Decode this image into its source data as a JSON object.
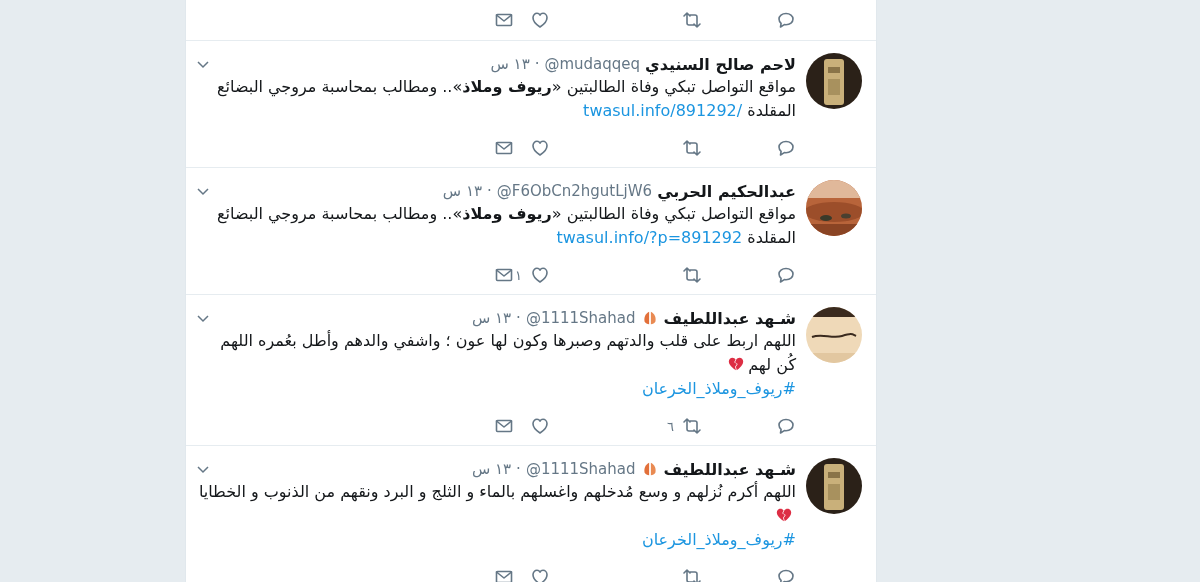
{
  "tweets": [
    {
      "actions": [
        {
          "kind": "reply"
        },
        {
          "kind": "retweet"
        },
        {
          "kind": "like"
        },
        {
          "kind": "message"
        }
      ]
    },
    {
      "avatar": {
        "kind": "picture"
      },
      "name": "لاحم صالح السنيدي",
      "handle": "@mudaqqeq",
      "separator": "·",
      "time": "١٣ س",
      "text": "مواقع التواصل تبكي وفاة الطالبتين «**ريوف وملاذ**».. ومطالب بمحاسبة مروجي البضائع المقلدة",
      "link": "twasul.info/891292/",
      "actions": [
        {
          "kind": "reply"
        },
        {
          "kind": "retweet"
        },
        {
          "kind": "like"
        },
        {
          "kind": "message"
        }
      ]
    },
    {
      "avatar": {
        "kind": "picture"
      },
      "name": "عبدالحكيم الحربي",
      "handle": "@F6ObCn2hgutLjW6",
      "separator": "·",
      "time": "١٣ س",
      "text": "مواقع التواصل تبكي وفاة الطالبتين «**ريوف وملاذ**».. ومطالب بمحاسبة مروجي البضائع المقلدة",
      "link": "twasul.info/?p=891292",
      "actions": [
        {
          "kind": "reply"
        },
        {
          "kind": "retweet"
        },
        {
          "kind": "like",
          "count": "١"
        },
        {
          "kind": "message"
        }
      ]
    },
    {
      "avatar": {
        "kind": "picture"
      },
      "name": "شـهد عبداللطيف",
      "name_badge": true,
      "handle": "@1111Shahad",
      "separator": "·",
      "time": "١٣ س",
      "text": "اللهم اربط على قلب والدتهم وصبرها وكون لها عون ؛ واشفي والدهم وأطل بعُمره اللهم كُن لهم",
      "broken_heart": true,
      "hashtag": "#ريوف_وملاذ_الخرعان",
      "actions": [
        {
          "kind": "reply"
        },
        {
          "kind": "retweet",
          "count": "٦"
        },
        {
          "kind": "like"
        },
        {
          "kind": "message"
        }
      ]
    },
    {
      "avatar": {
        "kind": "picture"
      },
      "name": "شـهد عبداللطيف",
      "name_badge": true,
      "handle": "@1111Shahad",
      "separator": "·",
      "time": "١٣ س",
      "text": "اللهم أكرم نُزلهم و وسع مُدخلهم واغسلهم بالماء و الثلج و البرد ونقهم من الذنوب و الخطايا",
      "broken_heart": true,
      "hashtag": "#ريوف_وملاذ_الخرعان",
      "actions": [
        {
          "kind": "reply"
        },
        {
          "kind": "retweet"
        },
        {
          "kind": "like"
        },
        {
          "kind": "message"
        }
      ]
    }
  ]
}
